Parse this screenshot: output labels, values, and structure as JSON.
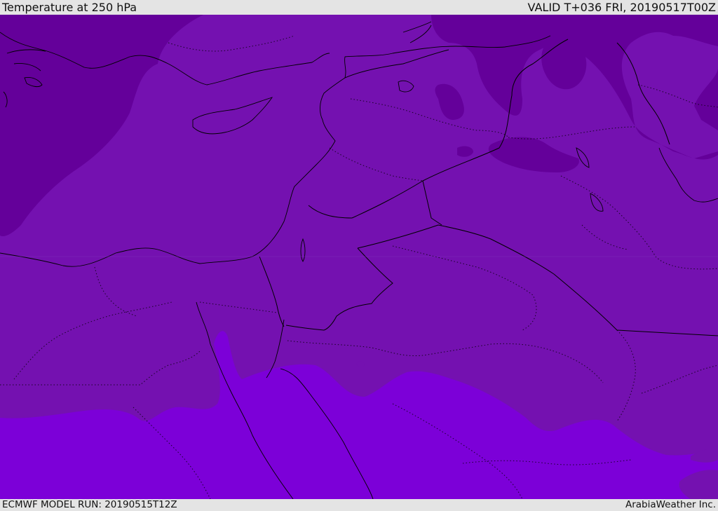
{
  "header": {
    "title": "Temperature at 250 hPa",
    "valid": "VALID T+036 FRI, 20190517T00Z"
  },
  "footer": {
    "model_run": "ECMWF MODEL RUN: 20190515T12Z",
    "credit": "ArabiaWeather Inc."
  },
  "colors": {
    "coldest": "#64009a",
    "middle": "#7411b0",
    "warmest": "#7c00d8"
  }
}
